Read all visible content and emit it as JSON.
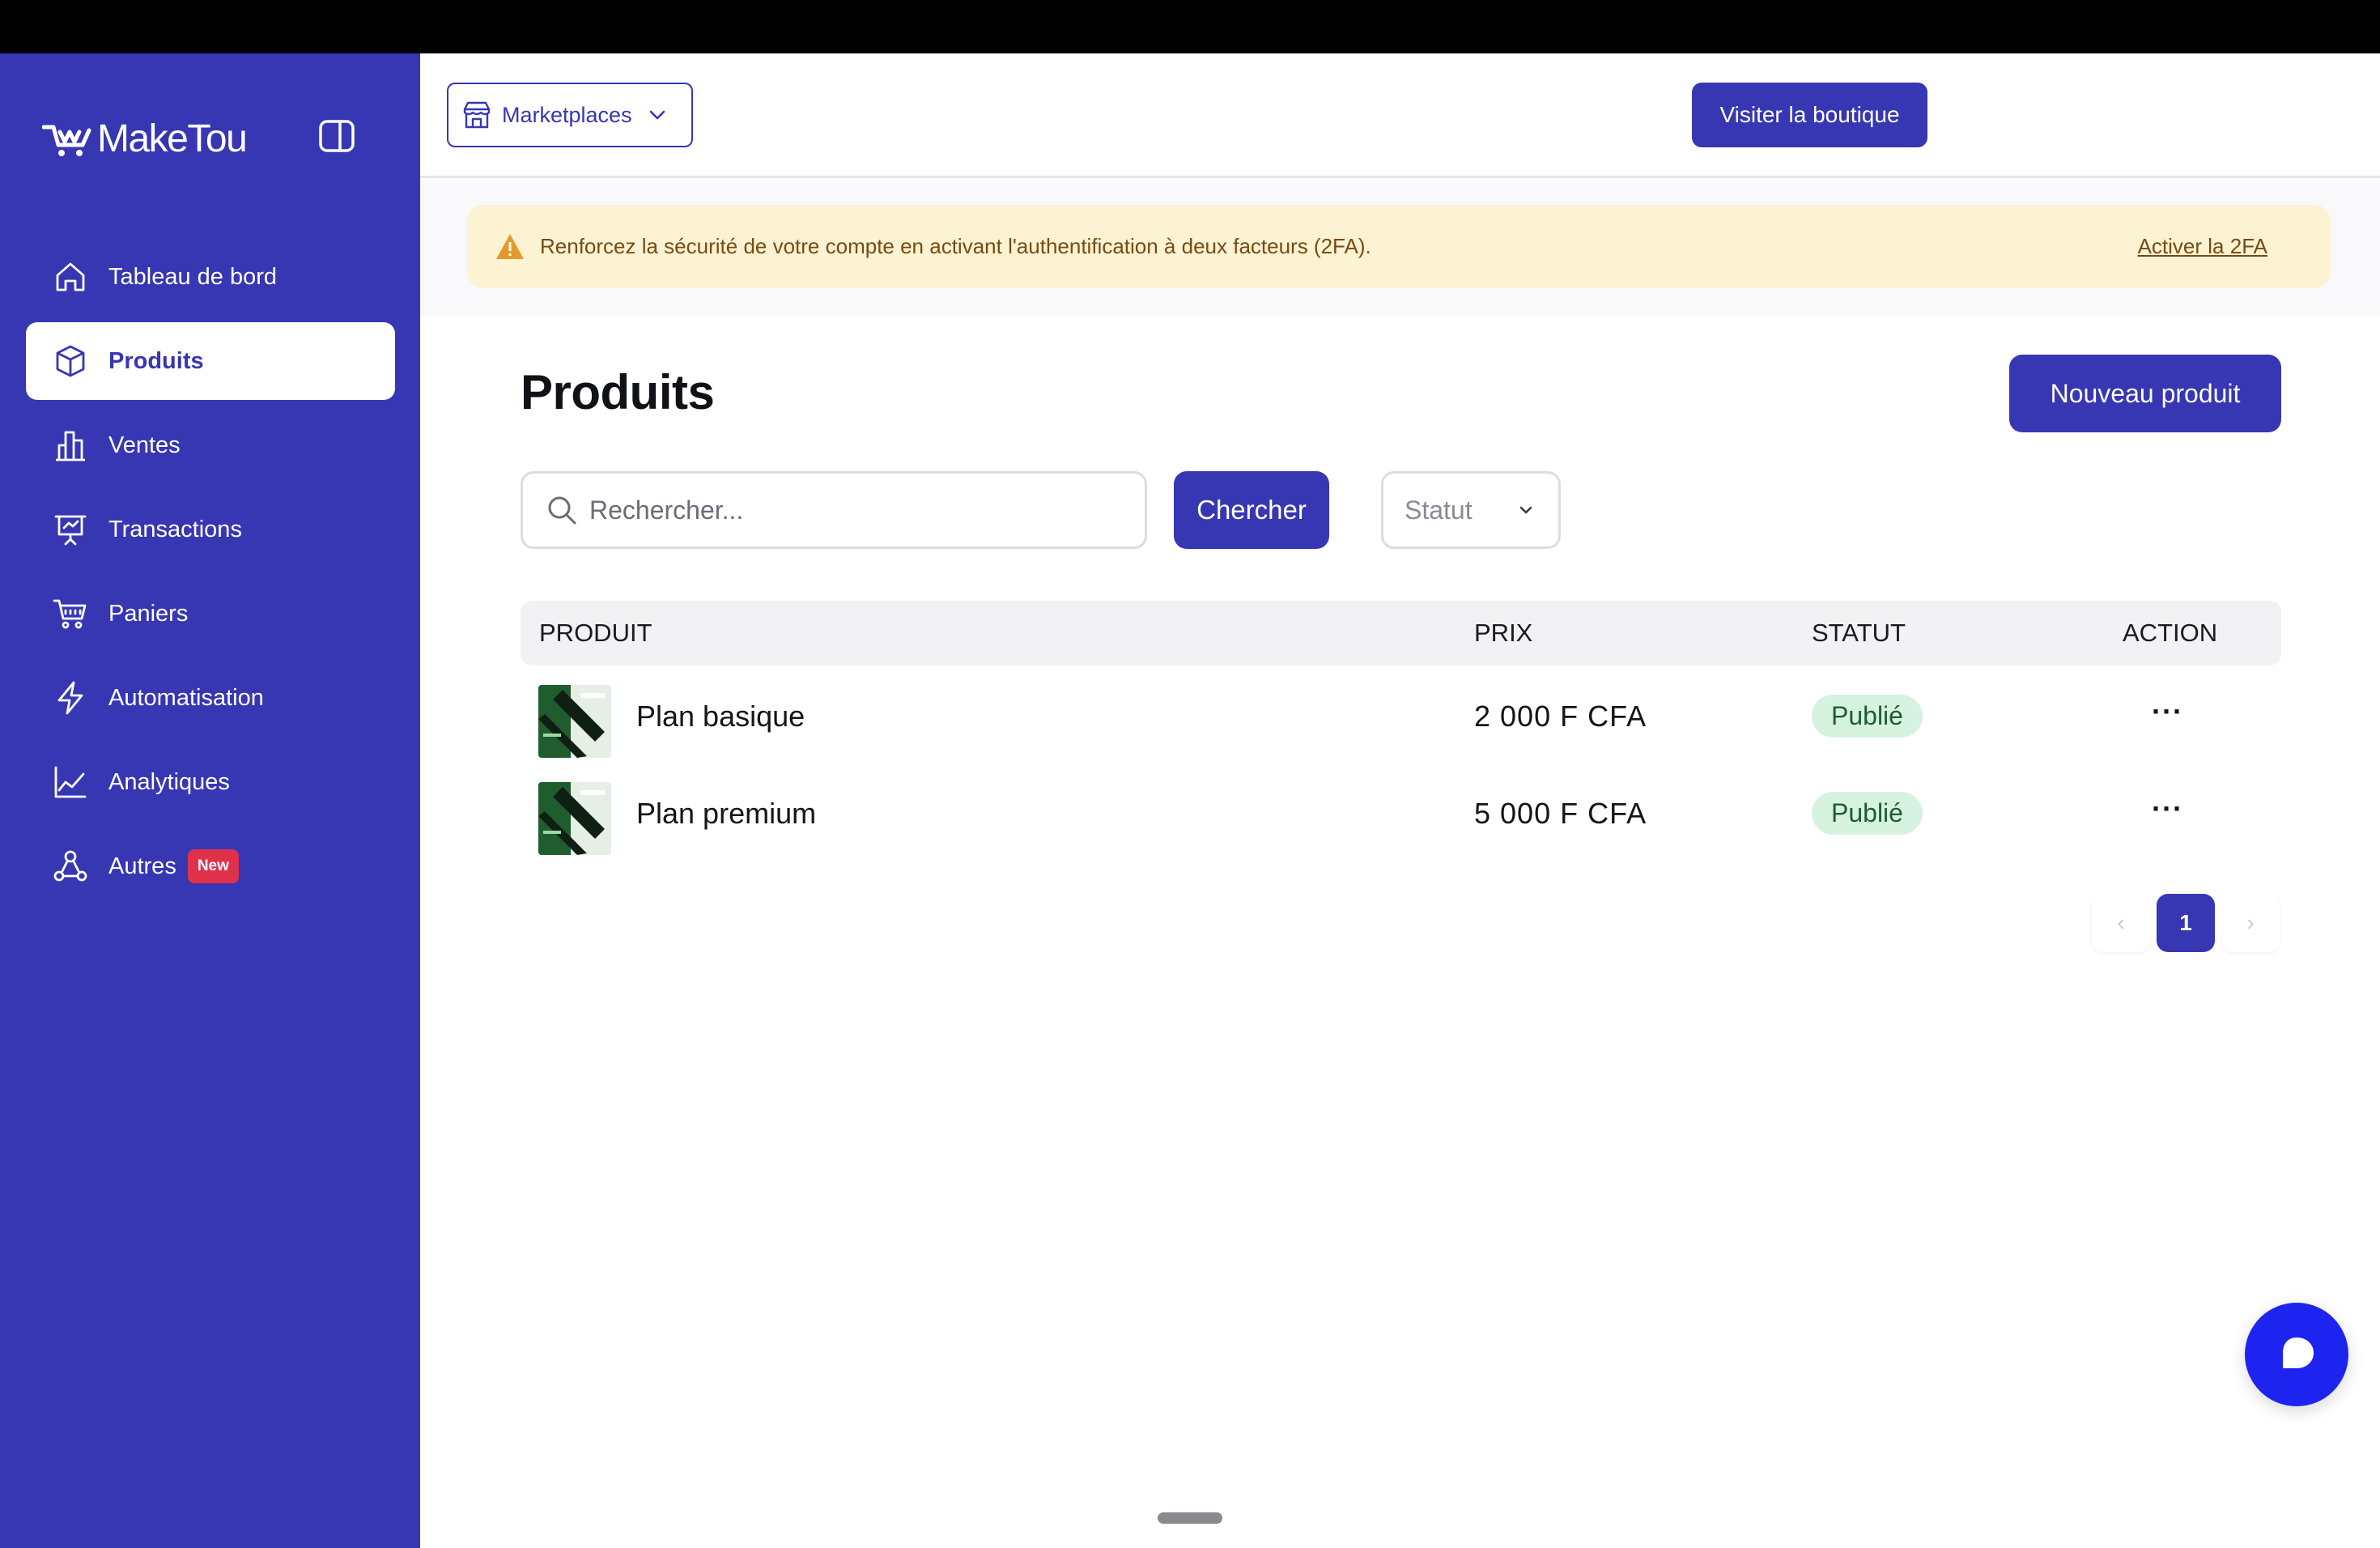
{
  "app": {
    "logo_text": "MakeTou"
  },
  "sidebar": {
    "items": [
      {
        "label": "Tableau de bord",
        "icon": "home-icon",
        "active": false
      },
      {
        "label": "Produits",
        "icon": "cube-icon",
        "active": true
      },
      {
        "label": "Ventes",
        "icon": "bar-chart-icon",
        "active": false
      },
      {
        "label": "Transactions",
        "icon": "presentation-icon",
        "active": false
      },
      {
        "label": "Paniers",
        "icon": "cart-icon",
        "active": false
      },
      {
        "label": "Automatisation",
        "icon": "lightning-icon",
        "active": false
      },
      {
        "label": "Analytiques",
        "icon": "line-chart-icon",
        "active": false
      },
      {
        "label": "Autres",
        "icon": "nodes-icon",
        "active": false,
        "badge": "New"
      }
    ]
  },
  "topbar": {
    "marketplaces_label": "Marketplaces",
    "visit_label": "Visiter la boutique"
  },
  "alert": {
    "text": "Renforcez la sécurité de votre compte en activant l'authentification à deux facteurs (2FA).",
    "link": "Activer la 2FA"
  },
  "main": {
    "title": "Produits",
    "new_button": "Nouveau produit",
    "search": {
      "placeholder": "Rechercher...",
      "button": "Chercher"
    },
    "status_filter": "Statut"
  },
  "table": {
    "headers": {
      "product": "PRODUIT",
      "price": "PRIX",
      "status": "STATUT",
      "action": "ACTION"
    },
    "rows": [
      {
        "name": "Plan basique",
        "price": "2 000 F CFA",
        "status": "Publié",
        "action": "···"
      },
      {
        "name": "Plan premium",
        "price": "5 000 F CFA",
        "status": "Publié",
        "action": "···"
      }
    ]
  },
  "pagination": {
    "prev": "‹",
    "current": "1",
    "next": "›"
  },
  "colors": {
    "brand": "#3736b3",
    "alert_bg": "#fbf3d2",
    "status_pill_bg": "#d6f3df",
    "chat_fab": "#1d24f0",
    "badge_new": "#e0314b"
  }
}
